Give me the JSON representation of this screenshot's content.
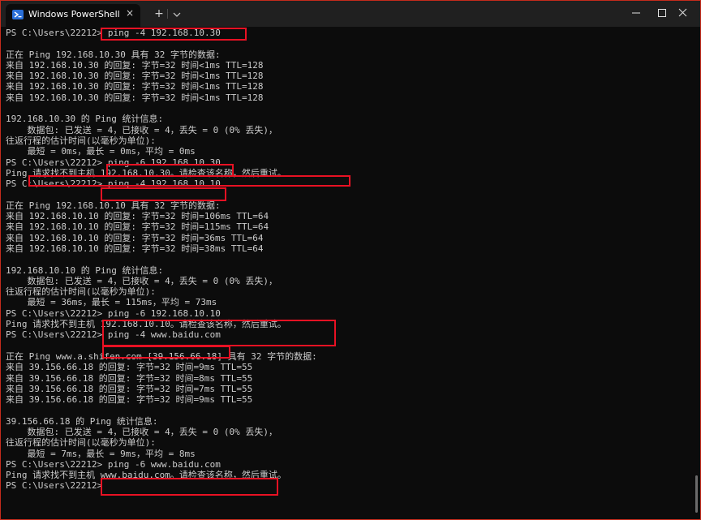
{
  "window": {
    "tab_title": "Windows PowerShell",
    "new_tab_label": "+",
    "tab_close_label": "×"
  },
  "icons": {
    "tab": "powershell-icon",
    "close_tab": "close-icon",
    "new_tab": "plus-icon",
    "dropdown": "chevron-down-icon",
    "minimize": "minimize-icon",
    "maximize": "maximize-icon",
    "close": "close-icon"
  },
  "colors": {
    "highlight": "#e81123",
    "background": "#0c0c0c",
    "text": "#cccccc",
    "titlebar": "#202020",
    "window_border": "#c42b1c"
  },
  "terminal": {
    "lines": [
      "PS C:\\Users\\22212> ping -4 192.168.10.30",
      "",
      "正在 Ping 192.168.10.30 具有 32 字节的数据:",
      "来自 192.168.10.30 的回复: 字节=32 时间<1ms TTL=128",
      "来自 192.168.10.30 的回复: 字节=32 时间<1ms TTL=128",
      "来自 192.168.10.30 的回复: 字节=32 时间<1ms TTL=128",
      "来自 192.168.10.30 的回复: 字节=32 时间<1ms TTL=128",
      "",
      "192.168.10.30 的 Ping 统计信息:",
      "    数据包: 已发送 = 4，已接收 = 4，丢失 = 0 (0% 丢失)，",
      "往返行程的估计时间(以毫秒为单位):",
      "    最短 = 0ms，最长 = 0ms，平均 = 0ms",
      "PS C:\\Users\\22212> ping -6 192.168.10.30",
      "Ping 请求找不到主机 192.168.10.30。请检查该名称，然后重试。",
      "PS C:\\Users\\22212> ping -4 192.168.10.10",
      "",
      "正在 Ping 192.168.10.10 具有 32 字节的数据:",
      "来自 192.168.10.10 的回复: 字节=32 时间=106ms TTL=64",
      "来自 192.168.10.10 的回复: 字节=32 时间=115ms TTL=64",
      "来自 192.168.10.10 的回复: 字节=32 时间=36ms TTL=64",
      "来自 192.168.10.10 的回复: 字节=32 时间=38ms TTL=64",
      "",
      "192.168.10.10 的 Ping 统计信息:",
      "    数据包: 已发送 = 4，已接收 = 4，丢失 = 0 (0% 丢失)，",
      "往返行程的估计时间(以毫秒为单位):",
      "    最短 = 36ms，最长 = 115ms，平均 = 73ms",
      "PS C:\\Users\\22212> ping -6 192.168.10.10",
      "Ping 请求找不到主机 192.168.10.10。请检查该名称，然后重试。",
      "PS C:\\Users\\22212> ping -4 www.baidu.com",
      "",
      "正在 Ping www.a.shifen.com [39.156.66.18] 具有 32 字节的数据:",
      "来自 39.156.66.18 的回复: 字节=32 时间=9ms TTL=55",
      "来自 39.156.66.18 的回复: 字节=32 时间=8ms TTL=55",
      "来自 39.156.66.18 的回复: 字节=32 时间=7ms TTL=55",
      "来自 39.156.66.18 的回复: 字节=32 时间=9ms TTL=55",
      "",
      "39.156.66.18 的 Ping 统计信息:",
      "    数据包: 已发送 = 4，已接收 = 4，丢失 = 0 (0% 丢失)，",
      "往返行程的估计时间(以毫秒为单位):",
      "    最短 = 7ms，最长 = 9ms，平均 = 8ms",
      "PS C:\\Users\\22212> ping -6 www.baidu.com",
      "Ping 请求找不到主机 www.baidu.com。请检查该名称，然后重试。",
      "PS C:\\Users\\22212>"
    ]
  }
}
